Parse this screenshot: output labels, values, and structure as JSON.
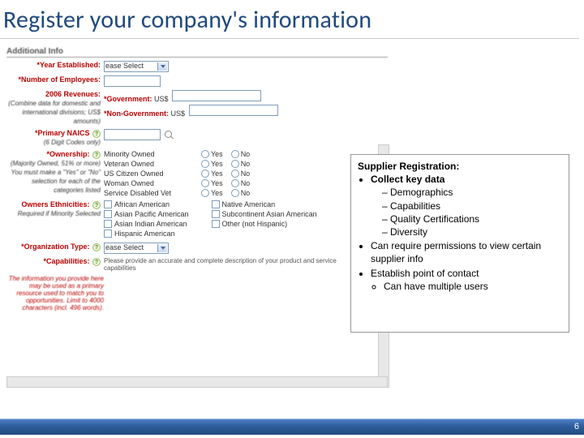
{
  "slide": {
    "title": "Register your company's information",
    "page_number": "6"
  },
  "form": {
    "section": "Additional Info",
    "year_est": {
      "label": "*Year Established:",
      "value": "ease Select"
    },
    "num_emp": {
      "label": "*Number of Employees:"
    },
    "revenues": {
      "label": "2006 Revenues:",
      "note": "(Combine data for domestic and international divisions; US$ amounts)",
      "gov_label": "*Government:",
      "nongov_label": "*Non-Government:",
      "prefix": "US$"
    },
    "naics": {
      "label": "*Primary NAICS",
      "note": "(6 Digit Codes only)"
    },
    "ownership": {
      "label": "*Ownership:",
      "note": "(Majority Owned, 51% or more) You must make a \"Yes\" or \"No\" selection for each of the categories listed",
      "rows": [
        "Minority Owned",
        "Veteran Owned",
        "US Citizen Owned",
        "Woman Owned",
        "Service Disabled Vet"
      ],
      "yes": "Yes",
      "no": "No"
    },
    "ethnicities": {
      "label": "Owners Ethnicities:",
      "note": "Required if Minority Selected",
      "col1": [
        "African American",
        "Asian Pacific American",
        "Asian Indian American",
        "Hispanic American"
      ],
      "col2": [
        "Native American",
        "Subcontinent Asian American",
        "Other (not Hispanic)"
      ]
    },
    "orgtype": {
      "label": "*Organization Type:",
      "value": "ease Select"
    },
    "capabilities": {
      "label": "*Capabilities:",
      "note": "The information you provide here may be used as a primary resource used to match you to opportunities. Limit to 4000 characters (incl. 496 words).",
      "desc": "Please provide an accurate and complete description of your product and service capabilities"
    }
  },
  "overlay": {
    "heading": "Supplier Registration:",
    "b1": "Collect key data",
    "s1": "Demographics",
    "s2": "Capabilities",
    "s3": "Quality Certifications",
    "s4": "Diversity",
    "b2": "Can require permissions to view certain supplier info",
    "b3": "Establish point of contact",
    "b3a": "Can have multiple users"
  }
}
